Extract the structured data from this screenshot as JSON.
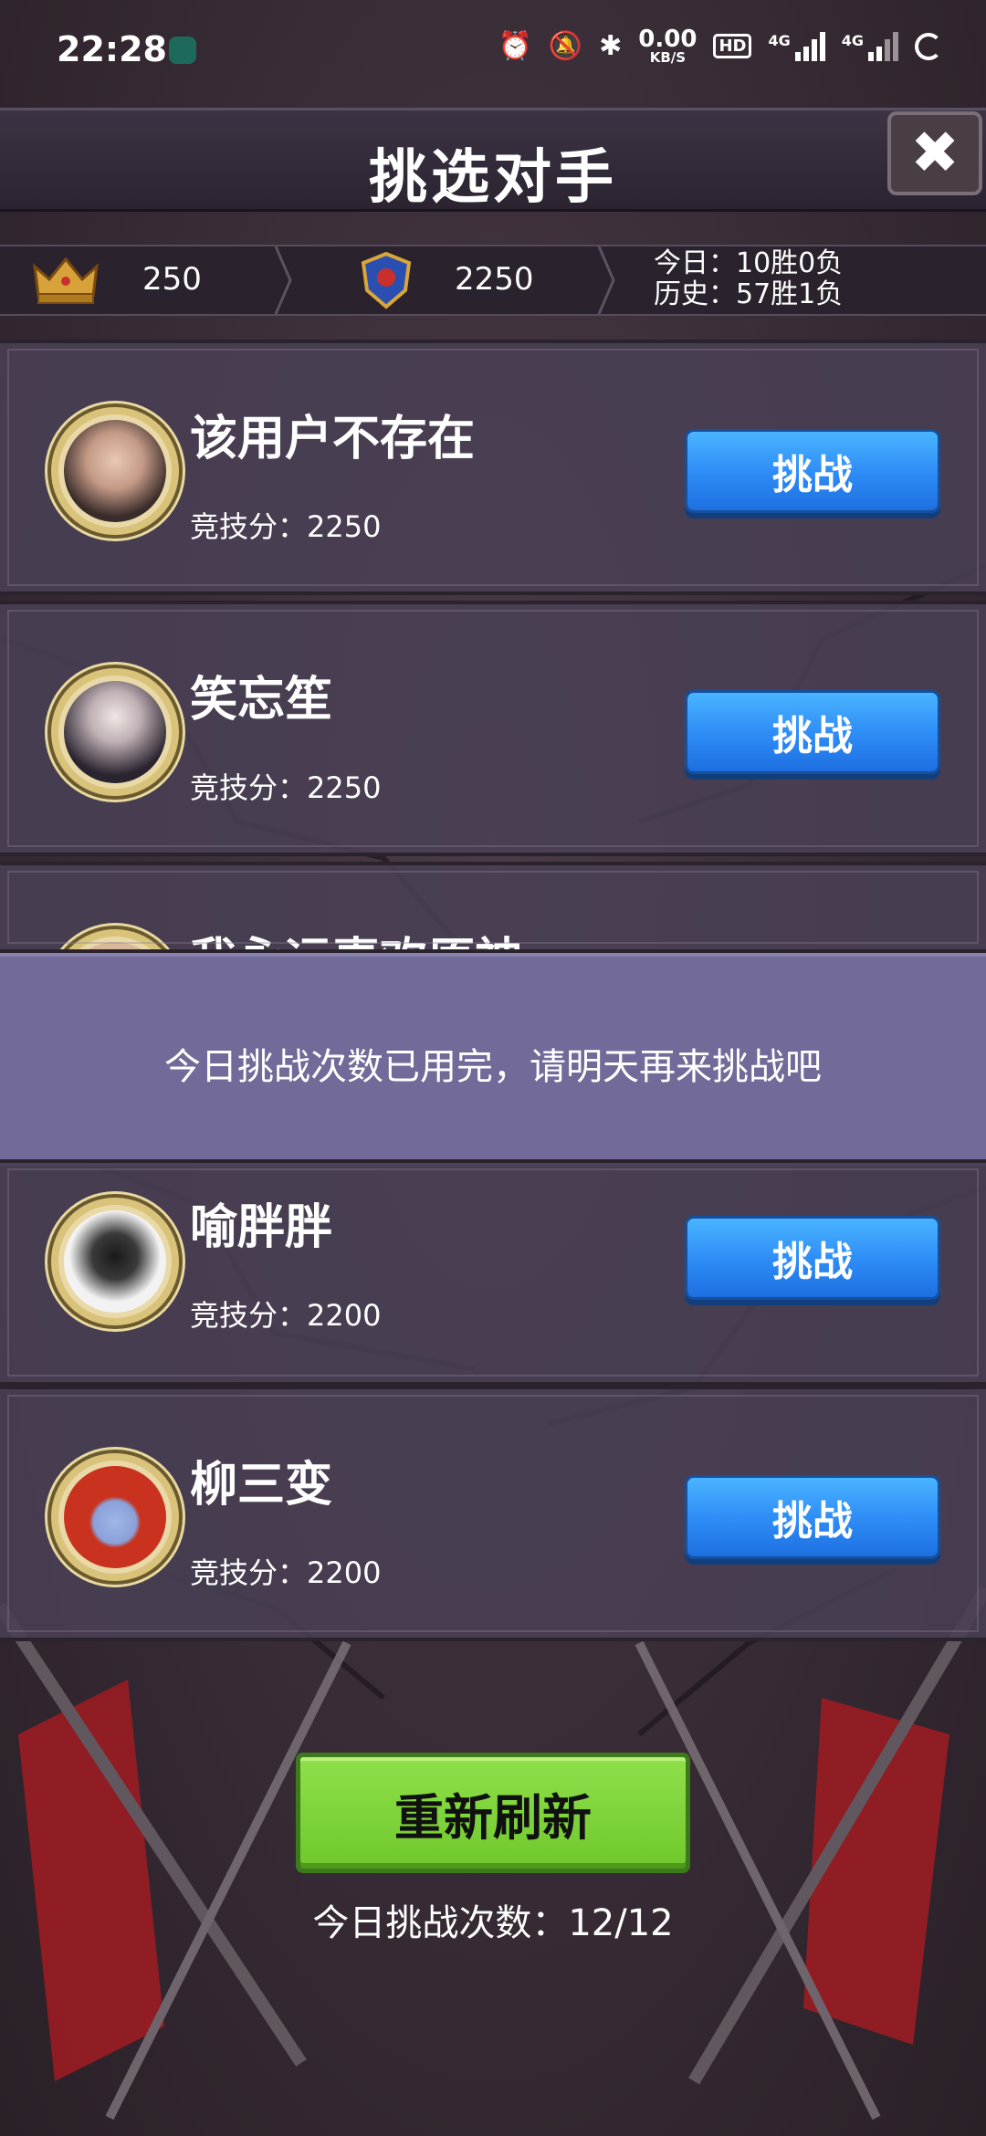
{
  "status_bar": {
    "time": "22:28",
    "net_speed_value": "0.00",
    "net_speed_unit": "KB/S",
    "hd_label": "HD",
    "signal_1_label": "4G",
    "signal_2_label": "4G",
    "icons": [
      "app-icon",
      "alarm-icon",
      "mute-icon",
      "bluetooth-icon",
      "signal-icon",
      "signal-icon",
      "loading-icon"
    ]
  },
  "header": {
    "title": "挑选对手",
    "close_icon": "close-icon"
  },
  "stats": {
    "crown_value": "250",
    "rank_score": "2250",
    "today_record": "今日：10胜0负",
    "history_record": "历史：57胜1负"
  },
  "opponents": [
    {
      "name": "该用户不存在",
      "score_label": "竞技分：2250",
      "button": "挑战"
    },
    {
      "name": "笑忘笙",
      "score_label": "竞技分：2250",
      "button": "挑战"
    },
    {
      "name": "我永远喜欢原神",
      "score_label": "",
      "button": ""
    },
    {
      "name": "喻胖胖",
      "score_label": "竞技分：2200",
      "button": "挑战"
    },
    {
      "name": "柳三变",
      "score_label": "竞技分：2200",
      "button": "挑战"
    }
  ],
  "toast": {
    "message": "今日挑战次数已用完，请明天再来挑战吧"
  },
  "footer": {
    "refresh_label": "重新刷新",
    "challenge_count": "今日挑战次数：12/12"
  },
  "colors": {
    "challenge_button": "#2f8ef7",
    "refresh_button": "#7fd43a",
    "toast_bg": "#726a98",
    "card_bg": "#4a4054"
  }
}
